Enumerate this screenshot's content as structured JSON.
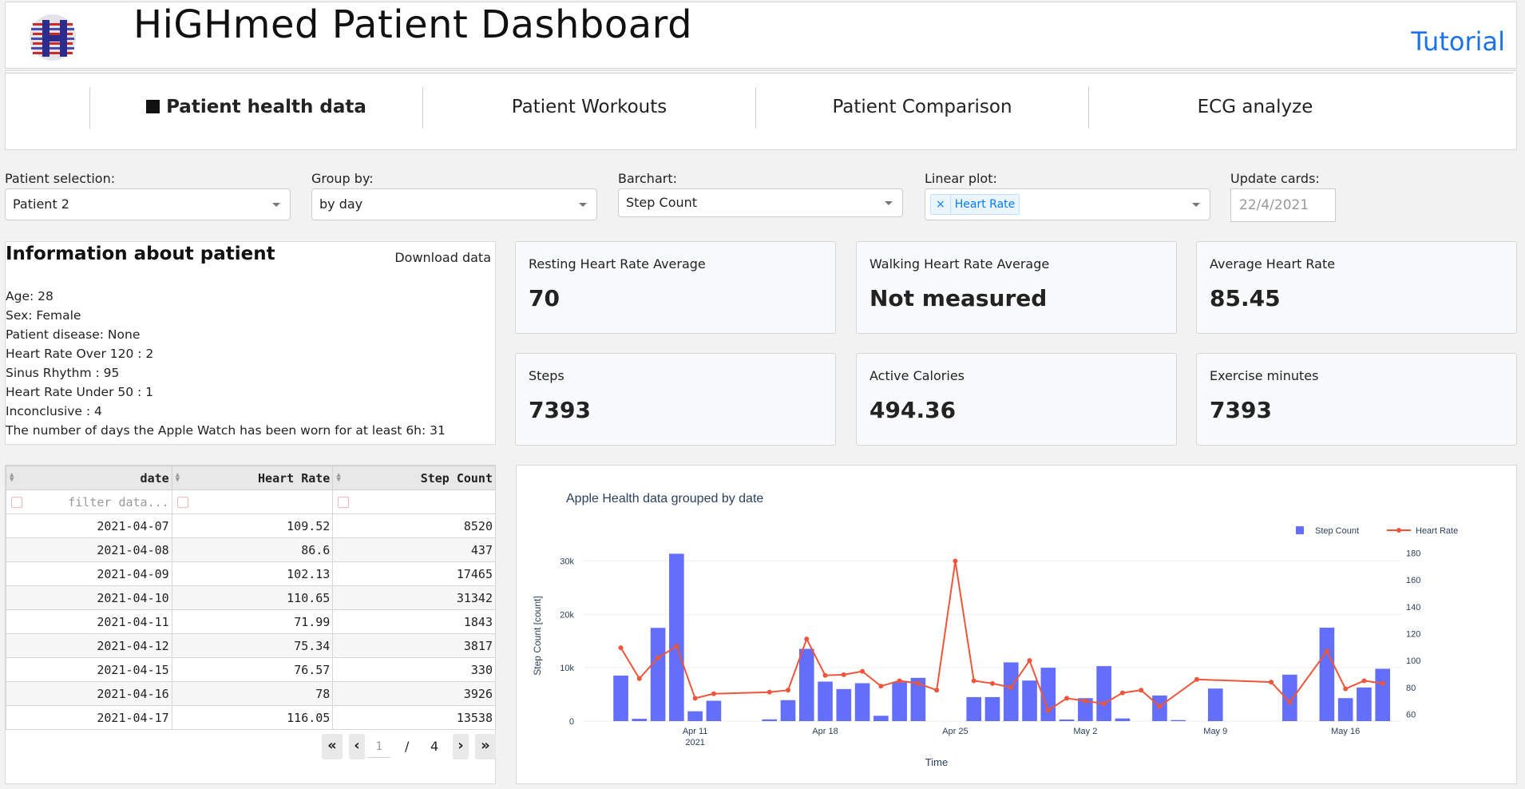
{
  "header": {
    "title": "HiGHmed Patient Dashboard",
    "tutorial_label": "Tutorial",
    "logo_icon": "highmed-logo-icon"
  },
  "tabs": [
    {
      "label": "Patient health data",
      "active": true
    },
    {
      "label": "Patient Workouts",
      "active": false
    },
    {
      "label": "Patient Comparison",
      "active": false
    },
    {
      "label": "ECG analyze",
      "active": false
    }
  ],
  "controls": {
    "patient_label": "Patient selection:",
    "patient_value": "Patient 2",
    "group_label": "Group by:",
    "group_value": "by day",
    "barchart_label": "Barchart:",
    "barchart_value": "Step Count",
    "linear_label": "Linear plot:",
    "linear_tag": "Heart Rate",
    "linear_tag_remove": "×",
    "update_label": "Update cards:",
    "update_placeholder": "22/4/2021"
  },
  "info": {
    "title": "Information about patient",
    "download_label": "Download data",
    "lines": [
      "Age: 28",
      "Sex: Female",
      "Patient disease: None",
      "Heart Rate Over 120 : 2",
      "Sinus Rhythm : 95",
      "Heart Rate Under 50 : 1",
      "Inconclusive : 4",
      "The number of days the Apple Watch has been worn for at least 6h: 31"
    ]
  },
  "cards": [
    {
      "label": "Resting Heart Rate Average",
      "value": "70"
    },
    {
      "label": "Walking Heart Rate Average",
      "value": "Not measured"
    },
    {
      "label": "Average Heart Rate",
      "value": "85.45"
    },
    {
      "label": "Steps",
      "value": "7393"
    },
    {
      "label": "Active Calories",
      "value": "494.36"
    },
    {
      "label": "Exercise minutes",
      "value": "7393"
    }
  ],
  "table": {
    "columns": [
      "date",
      "Heart Rate",
      "Step Count"
    ],
    "filter_placeholder": "filter data...",
    "rows": [
      [
        "2021-04-07",
        "109.52",
        "8520"
      ],
      [
        "2021-04-08",
        "86.6",
        "437"
      ],
      [
        "2021-04-09",
        "102.13",
        "17465"
      ],
      [
        "2021-04-10",
        "110.65",
        "31342"
      ],
      [
        "2021-04-11",
        "71.99",
        "1843"
      ],
      [
        "2021-04-12",
        "75.34",
        "3817"
      ],
      [
        "2021-04-15",
        "76.57",
        "330"
      ],
      [
        "2021-04-16",
        "78",
        "3926"
      ],
      [
        "2021-04-17",
        "116.05",
        "13538"
      ]
    ],
    "pager": {
      "first": "«",
      "prev": "‹",
      "current": "1",
      "slash": "/",
      "total": "4",
      "next": "›",
      "last": "»"
    }
  },
  "colors": {
    "bar": "#636efa",
    "line": "#ef553b",
    "tutorial": "#1a73e8"
  },
  "chart_data": {
    "type": "bar",
    "title": "Apple Health data grouped by date",
    "xlabel": "Time",
    "ylabel": "Step Count [count]",
    "ylim": [
      0,
      32000
    ],
    "y2lim": [
      55,
      182
    ],
    "y_ticks": [
      0,
      10000,
      20000,
      30000
    ],
    "y_tick_labels": [
      "0",
      "10k",
      "20k",
      "30k"
    ],
    "y2_ticks": [
      60,
      80,
      100,
      120,
      140,
      160,
      180
    ],
    "x_ticks": [
      "2021-04-11",
      "2021-04-18",
      "2021-04-25",
      "2021-05-02",
      "2021-05-09",
      "2021-05-16"
    ],
    "x_tick_labels": [
      "Apr 11",
      "Apr 18",
      "Apr 25",
      "May 2",
      "May 9",
      "May 16"
    ],
    "x_year_label": "2021",
    "x_range": [
      "2021-04-05",
      "2021-05-19"
    ],
    "legend_position": "top-right",
    "series": [
      {
        "name": "Step Count",
        "kind": "bar",
        "axis": "left",
        "points": [
          [
            "2021-04-07",
            8520
          ],
          [
            "2021-04-08",
            437
          ],
          [
            "2021-04-09",
            17465
          ],
          [
            "2021-04-10",
            31342
          ],
          [
            "2021-04-11",
            1843
          ],
          [
            "2021-04-12",
            3817
          ],
          [
            "2021-04-15",
            330
          ],
          [
            "2021-04-16",
            3926
          ],
          [
            "2021-04-17",
            13538
          ],
          [
            "2021-04-18",
            7400
          ],
          [
            "2021-04-19",
            6000
          ],
          [
            "2021-04-20",
            7100
          ],
          [
            "2021-04-21",
            1000
          ],
          [
            "2021-04-22",
            7300
          ],
          [
            "2021-04-23",
            8100
          ],
          [
            "2021-04-26",
            4500
          ],
          [
            "2021-04-27",
            4500
          ],
          [
            "2021-04-28",
            11000
          ],
          [
            "2021-04-29",
            7600
          ],
          [
            "2021-04-30",
            10000
          ],
          [
            "2021-05-01",
            300
          ],
          [
            "2021-05-02",
            4300
          ],
          [
            "2021-05-03",
            10300
          ],
          [
            "2021-05-04",
            500
          ],
          [
            "2021-05-06",
            4800
          ],
          [
            "2021-05-07",
            200
          ],
          [
            "2021-05-09",
            6100
          ],
          [
            "2021-05-13",
            8700
          ],
          [
            "2021-05-15",
            17500
          ],
          [
            "2021-05-16",
            4300
          ],
          [
            "2021-05-17",
            6300
          ],
          [
            "2021-05-18",
            9800
          ]
        ]
      },
      {
        "name": "Heart Rate",
        "kind": "line",
        "axis": "right",
        "points": [
          [
            "2021-04-07",
            109.52
          ],
          [
            "2021-04-08",
            86.6
          ],
          [
            "2021-04-09",
            102.13
          ],
          [
            "2021-04-10",
            110.65
          ],
          [
            "2021-04-11",
            71.99
          ],
          [
            "2021-04-12",
            75.34
          ],
          [
            "2021-04-15",
            76.57
          ],
          [
            "2021-04-16",
            78
          ],
          [
            "2021-04-17",
            116.05
          ],
          [
            "2021-04-18",
            89
          ],
          [
            "2021-04-19",
            89.5
          ],
          [
            "2021-04-20",
            92
          ],
          [
            "2021-04-21",
            81
          ],
          [
            "2021-04-22",
            85
          ],
          [
            "2021-04-23",
            83
          ],
          [
            "2021-04-24",
            78
          ],
          [
            "2021-04-25",
            174
          ],
          [
            "2021-04-26",
            85
          ],
          [
            "2021-04-27",
            83
          ],
          [
            "2021-04-28",
            80
          ],
          [
            "2021-04-29",
            100
          ],
          [
            "2021-04-30",
            63
          ],
          [
            "2021-05-01",
            72
          ],
          [
            "2021-05-02",
            70
          ],
          [
            "2021-05-03",
            68
          ],
          [
            "2021-05-04",
            76
          ],
          [
            "2021-05-05",
            78
          ],
          [
            "2021-05-06",
            66
          ],
          [
            "2021-05-08",
            86
          ],
          [
            "2021-05-12",
            84
          ],
          [
            "2021-05-13",
            69
          ],
          [
            "2021-05-15",
            107
          ],
          [
            "2021-05-16",
            79
          ],
          [
            "2021-05-17",
            85
          ],
          [
            "2021-05-18",
            83
          ]
        ]
      }
    ]
  }
}
